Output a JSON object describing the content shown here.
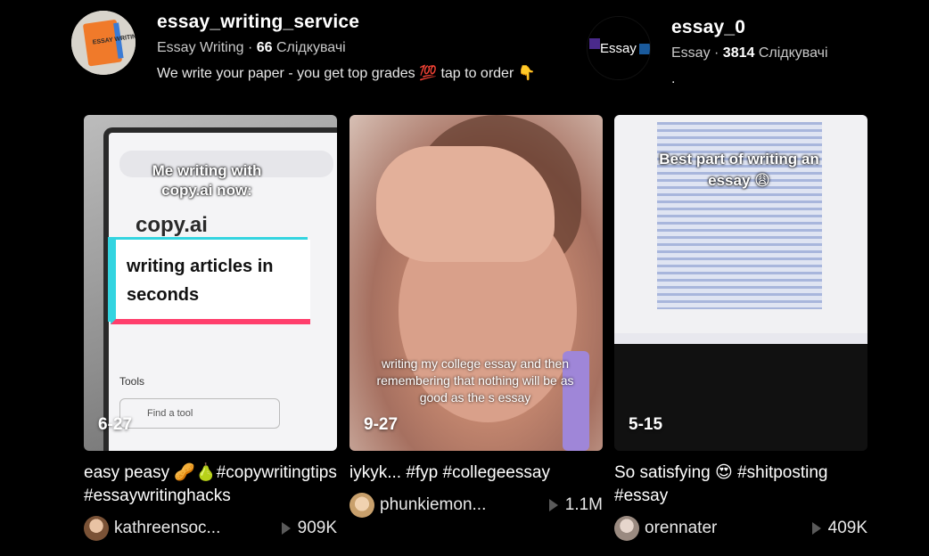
{
  "accounts": [
    {
      "username": "essay_writing_service",
      "display_name": "Essay Writing",
      "followers": "66",
      "followers_label": "Слідкувачі",
      "bio": "We write your paper - you get top grades 💯 tap to order 👇",
      "avatar_text": "ESSAY WRITING"
    },
    {
      "username": "essay_0",
      "display_name": "Essay",
      "followers": "3814",
      "followers_label": "Слідкувачі",
      "bio": ".",
      "avatar_text": "Essay"
    }
  ],
  "videos": [
    {
      "date": "6-27",
      "caption": "easy peasy 🥜🍐#copywritingtips #essaywritinghacks",
      "author": "kathreensoc...",
      "views": "909K",
      "overlay_top": "Me writing with copy.ai now:",
      "overlay_box": "writing articles in seconds",
      "screen_logo": "copy.ai",
      "screen_tools": "Tools",
      "screen_find": "Find a tool"
    },
    {
      "date": "9-27",
      "caption": "iykyk... #fyp #collegeessay",
      "author": "phunkiemon...",
      "views": "1.1M",
      "overlay_text": "writing my college essay and then remembering that nothing will be as good as the s essay"
    },
    {
      "date": "5-15",
      "caption": "So satisfying 😍 #shitposting #essay",
      "author": "orennater",
      "views": "409K",
      "overlay_text": "Best part of writing an essay 😩"
    }
  ],
  "colors": {
    "background": "#000000",
    "text_primary": "#ffffff",
    "text_secondary": "#c9c9c9",
    "accent_cyan": "#33d4e0",
    "accent_pink": "#ff3e6c"
  }
}
